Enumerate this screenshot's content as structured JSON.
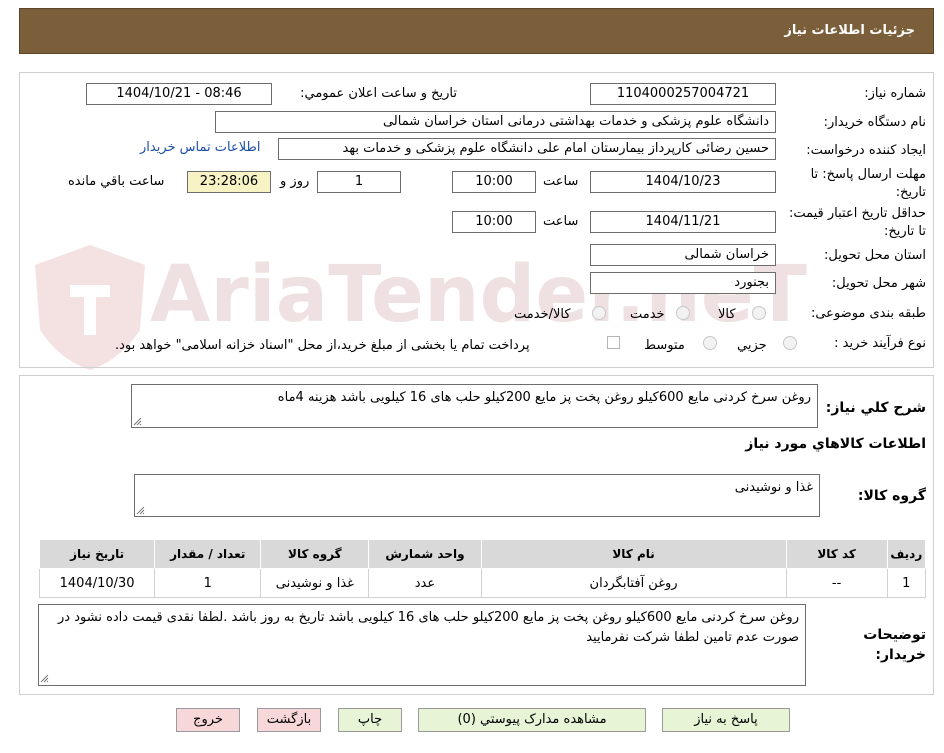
{
  "header": {
    "title": "جزئیات اطلاعات نیاز"
  },
  "form": {
    "need_number_label": "شماره نیاز:",
    "need_number": "1104000257004721",
    "announce_label": "تاریخ و ساعت اعلان عمومي:",
    "announce_value": "1404/10/21 - 08:46",
    "buyer_org_label": "نام دستگاه خريدار:",
    "buyer_org": "دانشگاه علوم پزشکی و خدمات بهداشتی درمانی استان خراسان شمالی",
    "requester_label": "ايجاد كننده درخواست:",
    "requester": "حسین رضائی کارپرداز بیمارستان امام علی دانشگاه علوم پزشکی و خدمات بهد",
    "contact_link": "اطلاعات تماس خريدار",
    "deadline_label": "مهلت ارسال پاسخ: تا تاريخ:",
    "deadline_date": "1404/10/23",
    "time_label": "ساعت",
    "deadline_time": "10:00",
    "days_value": "1",
    "days_label": "روز و",
    "remaining_time": "23:28:06",
    "remaining_label": "ساعت باقي مانده",
    "validity_label": "حداقل تاريخ اعتبار قيمت: تا تاريخ:",
    "validity_date": "1404/11/21",
    "validity_time": "10:00",
    "province_label": "استان محل تحويل:",
    "province": "خراسان شمالی",
    "city_label": "شهر محل تحويل:",
    "city": "بجنورد",
    "category_label": "طبقه بندی موضوعی:",
    "category_options": [
      "کالا",
      "خدمت",
      "کالا/خدمت"
    ],
    "process_label": "نوع فرآيند خريد :",
    "process_options": [
      "جزيي",
      "متوسط"
    ],
    "payment_note": "پرداخت تمام یا بخشی از مبلغ خرید،از محل \"اسناد خزانه اسلامی\" خواهد بود."
  },
  "need": {
    "summary_label": "شرح كلي نياز:",
    "summary": "روغن سرخ کردنی مایع 600کیلو روغن پخت پز مایع 200کیلو حلب های 16 کیلویی باشد  هزینه 4ماه",
    "goods_info_title": "اطلاعات كالاهاي مورد نياز",
    "goods_group_label": "گروه كالا:",
    "goods_group": "غذا و نوشیدنی"
  },
  "table": {
    "headers": [
      "رديف",
      "كد كالا",
      "نام كالا",
      "واحد شمارش",
      "گروه كالا",
      "تعداد / مقدار",
      "تاريخ نياز"
    ],
    "rows": [
      [
        "1",
        "--",
        "روغن آفتابگردان",
        "عدد",
        "غذا و نوشیدنی",
        "1",
        "1404/10/30"
      ]
    ]
  },
  "buyer_notes": {
    "label": "توضيحات خريدار:",
    "text": "روغن سرخ کردنی مایع 600کیلو روغن پخت پز مایع 200کیلو حلب های 16 کیلویی باشد  تاریخ به روز باشد .لطفا نقدی قیمت داده نشود در صورت عدم تامین لطفا شرکت نفرمایید"
  },
  "buttons": {
    "respond": "پاسخ به نياز",
    "view_docs": "مشاهده مدارک پيوستي (0)",
    "print": "چاپ",
    "back": "بازگشت",
    "exit": "خروج"
  },
  "watermark": {
    "text": "AriaTender.neT"
  },
  "colors": {
    "header_bg": "#7b5f3b",
    "link": "#1d4fa8",
    "remaining_bg": "#f7f3c5",
    "button_green": "#e7f4d6",
    "button_pink": "#f8d7d8"
  }
}
